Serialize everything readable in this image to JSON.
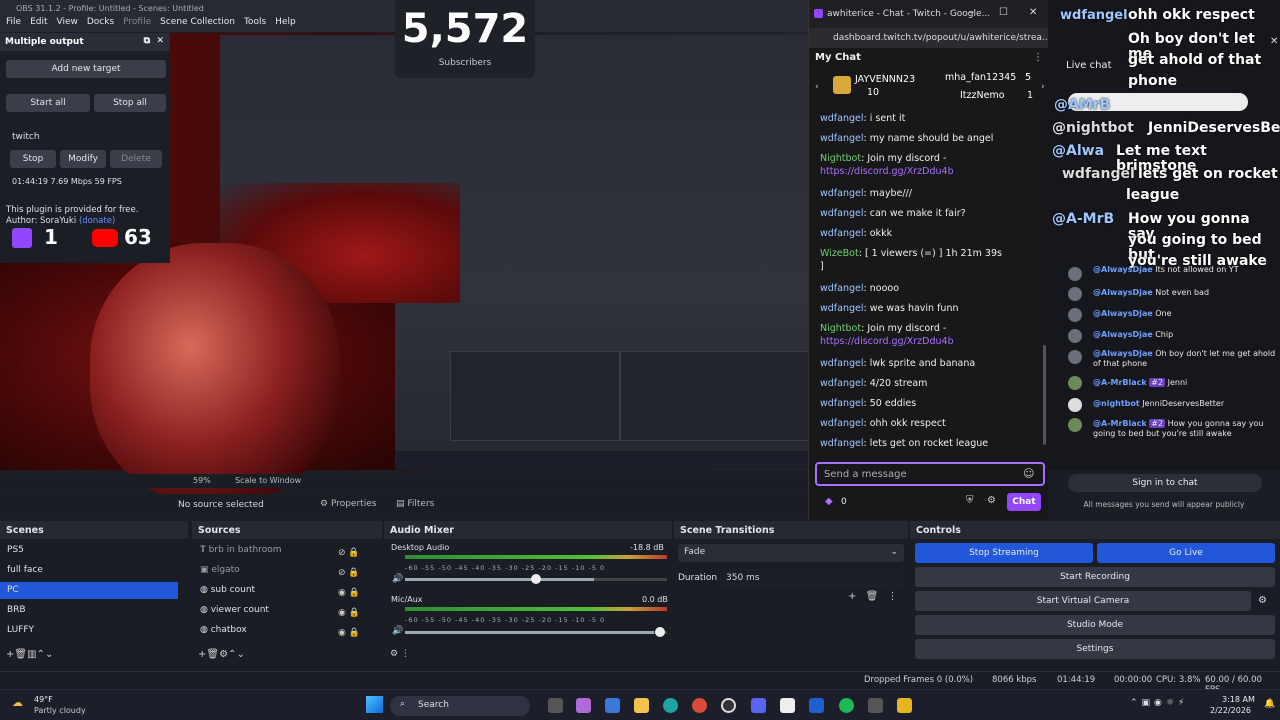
{
  "app": {
    "title": "OBS 31.1.2 - Profile: Untitled - Scenes: Untitled"
  },
  "menu": [
    "File",
    "Edit",
    "View",
    "Docks",
    "Profile",
    "Scene Collection",
    "Tools",
    "Help"
  ],
  "multiple_output": {
    "header": "Multiple output",
    "add_target": "Add new target",
    "start_all": "Start all",
    "stop_all": "Stop all",
    "target_name": "twitch",
    "stop": "Stop",
    "modify": "Modify",
    "delete": "Delete",
    "stats": "01:44:19  7.69 Mbps  59 FPS",
    "plugin_line1": "This plugin is provided for free.",
    "plugin_line2": "Author: SoraYuki",
    "plugin_donate": "(donate)"
  },
  "overlay_counts": {
    "twitch": "1",
    "youtube": "63"
  },
  "subscribers": {
    "count": "5,572",
    "label": "Subscribers"
  },
  "preview": {
    "zoom": "59%",
    "scale_mode": "Scale to Window"
  },
  "source_toolbar": {
    "no_source": "No source selected",
    "properties": "Properties",
    "filters": "Filters"
  },
  "chat_window": {
    "title": "awhiterice - Chat - Twitch - Google...",
    "url": "dashboard.twitch.tv/popout/u/awhiterice/strea...",
    "header": "My Chat",
    "leaders": [
      {
        "name": "JAYVENNN23",
        "count": "10"
      },
      {
        "name": "mha_fan12345",
        "count": "5"
      },
      {
        "name": "ItzzNemo",
        "count": "1"
      }
    ],
    "messages": [
      {
        "user": "wdfangel",
        "text": "i sent it"
      },
      {
        "user": "wdfangel",
        "text": "my name should be angel"
      },
      {
        "user": "Nightbot",
        "text": "Join my discord -",
        "link": "https://discord.gg/XrzDdu4b"
      },
      {
        "user": "wdfangel",
        "text": "maybe///"
      },
      {
        "user": "wdfangel",
        "text": "can we make it fair?"
      },
      {
        "user": "wdfangel",
        "text": "okkk"
      },
      {
        "user": "WizeBot",
        "text": "[ 1 viewers (=) ] 1h 21m 39s",
        "text2": "]"
      },
      {
        "user": "wdfangel",
        "text": "noooo"
      },
      {
        "user": "wdfangel",
        "text": "we was havin funn"
      },
      {
        "user": "Nightbot",
        "text": "Join my discord -",
        "link": "https://discord.gg/XrzDdu4b"
      },
      {
        "user": "wdfangel",
        "text": "lwk sprite and banana"
      },
      {
        "user": "wdfangel",
        "text": "4/20 stream"
      },
      {
        "user": "wdfangel",
        "text": "50 eddies"
      },
      {
        "user": "wdfangel",
        "text": "ohh okk respect"
      },
      {
        "user": "wdfangel",
        "text": "lets get on rocket league"
      }
    ],
    "send_placeholder": "Send a message",
    "points": "0",
    "chat_button": "Chat"
  },
  "overlay_chat": {
    "top_user": "wdfangel",
    "top_msg": "ohh okk respect",
    "live_chat": "Live chat",
    "big_lines": [
      "Oh boy don't let me",
      "get ahold of that",
      "phone",
      "JenniDeservesBetter",
      "Let me text brimstone",
      "lets get on rocket",
      "league",
      "How you gonna say",
      "you going to bed but",
      "you're still awake"
    ],
    "big_users": [
      "@AMrB",
      "@nightbot",
      "@Alwa",
      "wdfangel",
      "@A-MrB"
    ],
    "small_msgs": [
      {
        "user": "@AlwaysDjae",
        "text": "One"
      },
      {
        "user": "@AlwaysDjae",
        "text": "Chip"
      },
      {
        "user": "@AlwaysDjae",
        "text": "Oh boy don't let me get ahold of that phone"
      },
      {
        "user": "@A-MrBlack",
        "badge": "#2",
        "text": "Jenni"
      },
      {
        "user": "@nightbot",
        "text": "JenniDeservesBetter"
      },
      {
        "user": "@A-MrBlack",
        "badge": "#2",
        "text": "How you gonna say you going to bed but you're still awake"
      },
      {
        "user": "@AlwaysDjae",
        "text": "Not even bad"
      },
      {
        "user": "@AlwaysDjae",
        "text": "Its not allowed on YT"
      }
    ],
    "sign_in": "Sign in to chat",
    "public_note": "All messages you send will appear publicly"
  },
  "scenes": {
    "header": "Scenes",
    "items": [
      "PS5",
      "full face",
      "PC",
      "BRB",
      "LUFFY"
    ],
    "selected": "PC"
  },
  "sources": {
    "header": "Sources",
    "items": [
      "brb in bathroom",
      "elgato",
      "sub count",
      "viewer count",
      "chatbox"
    ]
  },
  "audio_mixer": {
    "header": "Audio Mixer",
    "tracks": [
      {
        "name": "Desktop Audio",
        "db": "-18.8 dB",
        "level": 0.72
      },
      {
        "name": "Mic/Aux",
        "db": "0.0 dB",
        "level": 0.95
      }
    ],
    "scale": "-60 -55 -50 -45 -40 -35 -30 -25 -20 -15 -10 -5 0"
  },
  "scene_transitions": {
    "header": "Scene Transitions",
    "transition": "Fade",
    "duration_label": "Duration",
    "duration": "350 ms"
  },
  "controls": {
    "header": "Controls",
    "stop_streaming": "Stop Streaming",
    "go_live": "Go Live",
    "start_recording": "Start Recording",
    "start_virtual_camera": "Start Virtual Camera",
    "studio_mode": "Studio Mode",
    "settings": "Settings"
  },
  "status": {
    "dropped": "Dropped Frames 0 (0.0%)",
    "bitrate": "8066 kbps",
    "stream_time": "01:44:19",
    "rec_time": "00:00:00",
    "cpu": "CPU: 3.8%",
    "fps": "60.00 / 60.00 FPS"
  },
  "taskbar": {
    "weather_temp": "49°F",
    "weather_desc": "Partly cloudy",
    "search": "Search",
    "time": "3:18 AM",
    "date": "2/22/2026"
  },
  "colors": {
    "accent": "#2357d9",
    "twitch": "#9147ff",
    "red_scene": "#8a1010"
  }
}
